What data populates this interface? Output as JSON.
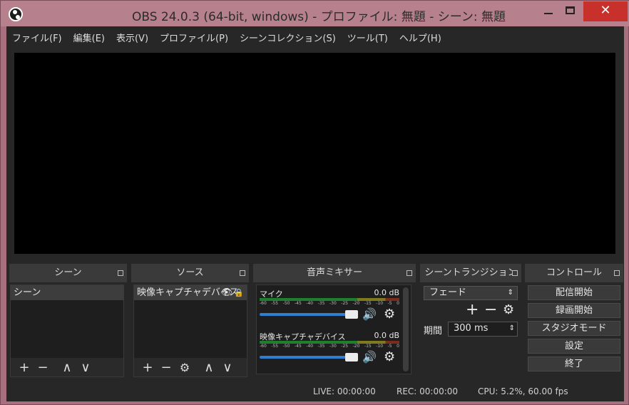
{
  "window": {
    "title": "OBS 24.0.3 (64-bit, windows) - プロファイル: 無題 - シーン: 無題",
    "close_glyph": "✕"
  },
  "menu": [
    "ファイル(F)",
    "編集(E)",
    "表示(V)",
    "プロファイル(P)",
    "シーンコレクション(S)",
    "ツール(T)",
    "ヘルプ(H)"
  ],
  "docks": {
    "scenes": {
      "title": "シーン",
      "items": [
        "シーン"
      ]
    },
    "sources": {
      "title": "ソース",
      "items": [
        "映像キャプチャデバイス"
      ]
    },
    "mixer": {
      "title": "音声ミキサー",
      "channels": [
        {
          "name": "マイク",
          "db": "0.0 dB"
        },
        {
          "name": "映像キャプチャデバイス",
          "db": "0.0 dB"
        }
      ],
      "scale": [
        "-60",
        "-55",
        "-50",
        "-45",
        "-40",
        "-35",
        "-30",
        "-25",
        "-20",
        "-15",
        "-10",
        "-5",
        "0"
      ]
    },
    "transitions": {
      "title": "シーントランジション",
      "selected": "フェード",
      "duration_label": "期間",
      "duration_value": "300 ms"
    },
    "controls": {
      "title": "コントロール",
      "buttons": [
        "配信開始",
        "録画開始",
        "スタジオモード",
        "設定",
        "終了"
      ]
    }
  },
  "toolbar": {
    "add": "+",
    "remove": "−",
    "up": "∧",
    "down": "∨",
    "gear": "⚙"
  },
  "status": {
    "live": "LIVE: 00:00:00",
    "rec": "REC: 00:00:00",
    "cpu": "CPU: 5.2%, 60.00 fps"
  }
}
